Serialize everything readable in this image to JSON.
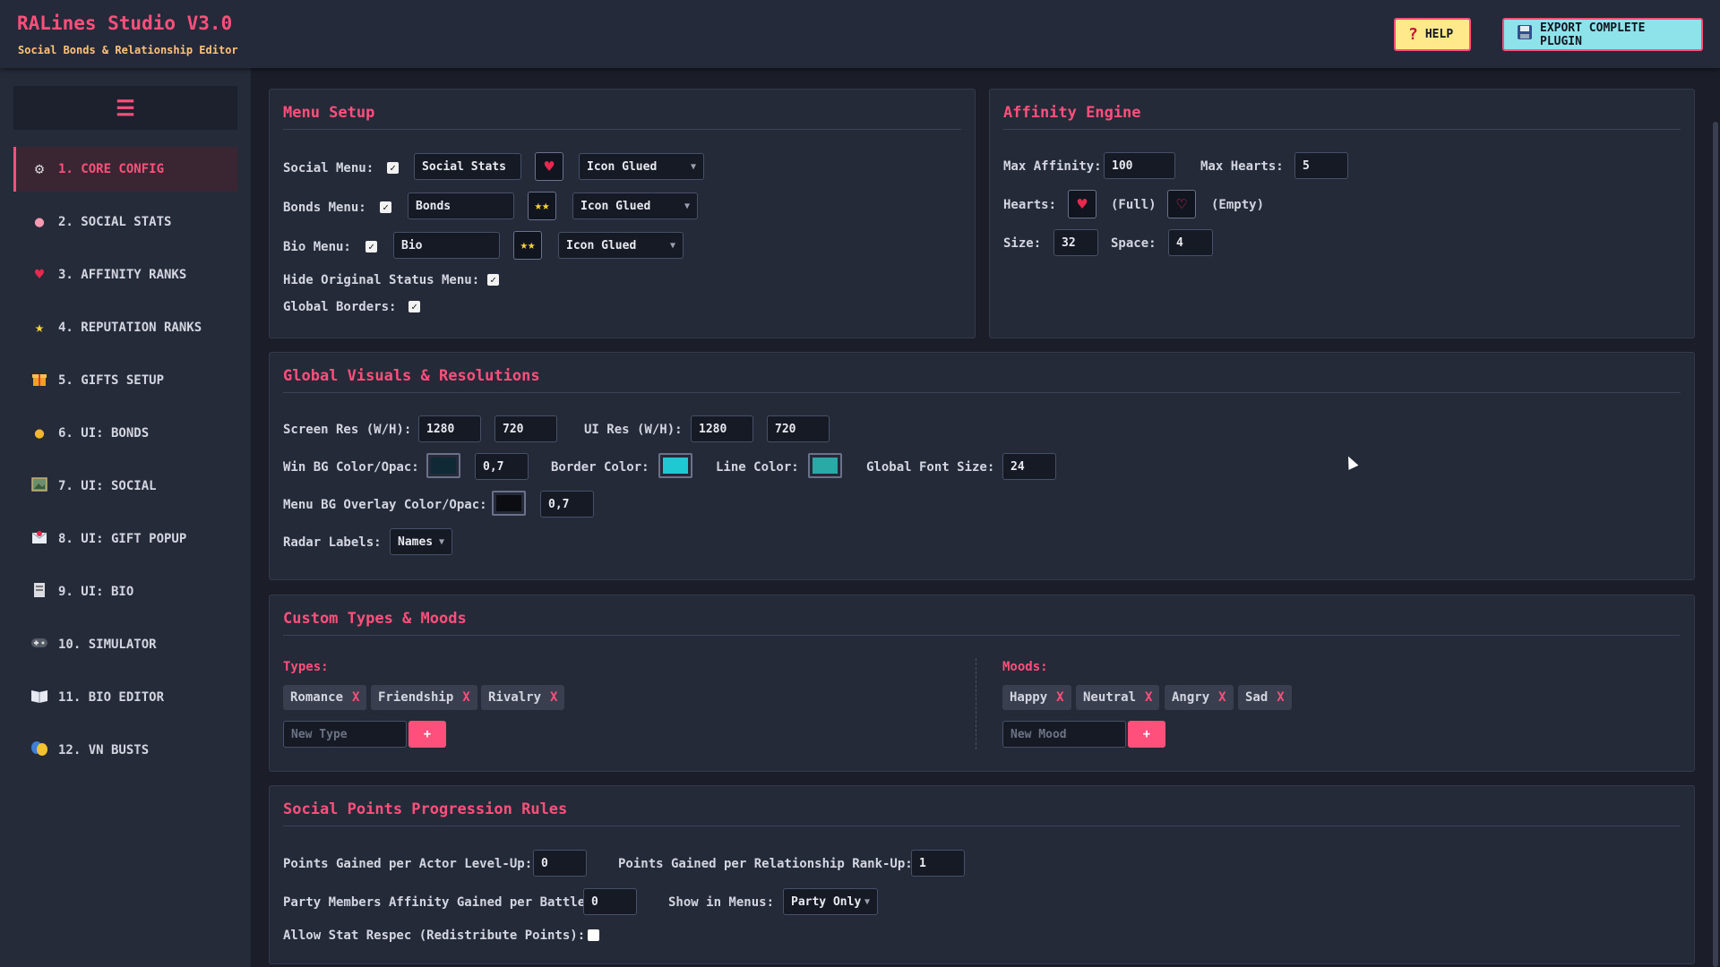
{
  "header": {
    "title": "RALines Studio V3.0",
    "subtitle": "Social Bonds & Relationship Editor",
    "help_label": "HELP",
    "export_label": "EXPORT COMPLETE PLUGIN",
    "help_icon": "question-icon",
    "export_icon": "floppy-disk-icon"
  },
  "sidebar": {
    "toggle_icon": "hamburger-icon",
    "items": [
      {
        "label": "1. CORE CONFIG",
        "icon": "gear-icon",
        "active": true
      },
      {
        "label": "2. SOCIAL STATS",
        "icon": "brain-icon"
      },
      {
        "label": "3. AFFINITY RANKS",
        "icon": "heart-icon"
      },
      {
        "label": "4. REPUTATION RANKS",
        "icon": "star-icon"
      },
      {
        "label": "5. GIFTS SETUP",
        "icon": "gift-icon"
      },
      {
        "label": "6. UI: BONDS",
        "icon": "palette-icon"
      },
      {
        "label": "7. UI: SOCIAL",
        "icon": "picture-icon"
      },
      {
        "label": "8. UI: GIFT POPUP",
        "icon": "envelope-icon"
      },
      {
        "label": "9. UI: BIO",
        "icon": "document-icon"
      },
      {
        "label": "10. SIMULATOR",
        "icon": "gamepad-icon"
      },
      {
        "label": "11. BIO EDITOR",
        "icon": "book-icon"
      },
      {
        "label": "12. VN BUSTS",
        "icon": "masks-icon"
      }
    ]
  },
  "menu_setup": {
    "title": "Menu Setup",
    "social_label": "Social Menu:",
    "social_name": "Social Stats",
    "social_mode": "Icon Glued",
    "bonds_label": "Bonds Menu:",
    "bonds_name": "Bonds",
    "bonds_mode": "Icon Glued",
    "bio_label": "Bio Menu:",
    "bio_name": "Bio",
    "bio_mode": "Icon Glued",
    "hide_label": "Hide Original Status Menu:",
    "borders_label": "Global Borders:"
  },
  "affinity": {
    "title": "Affinity Engine",
    "max_affinity_label": "Max Affinity:",
    "max_affinity": "100",
    "max_hearts_label": "Max Hearts:",
    "max_hearts": "5",
    "hearts_label": "Hearts:",
    "full_label": "(Full)",
    "empty_label": "(Empty)",
    "size_label": "Size:",
    "size": "32",
    "space_label": "Space:",
    "space": "4"
  },
  "visuals": {
    "title": "Global Visuals & Resolutions",
    "screen_res_label": "Screen Res (W/H):",
    "screen_w": "1280",
    "screen_h": "720",
    "ui_res_label": "UI Res (W/H):",
    "ui_w": "1280",
    "ui_h": "720",
    "win_bg_label": "Win BG Color/Opac:",
    "win_bg_opac": "0,7",
    "border_label": "Border Color:",
    "line_label": "Line Color:",
    "font_size_label": "Global Font Size:",
    "font_size": "24",
    "overlay_label": "Menu BG Overlay Color/Opac:",
    "overlay_opac": "0,7",
    "radar_label": "Radar Labels:",
    "radar_value": "Names",
    "colors": {
      "win_bg": "#0f2a35",
      "border": "#1ec9d3",
      "line": "#2aaaa6",
      "overlay": "#0b0d12"
    }
  },
  "custom": {
    "title": "Custom Types & Moods",
    "types_label": "Types:",
    "types": [
      "Romance",
      "Friendship",
      "Rivalry"
    ],
    "new_type_placeholder": "New Type",
    "moods_label": "Moods:",
    "moods": [
      "Happy",
      "Neutral",
      "Angry",
      "Sad"
    ],
    "new_mood_placeholder": "New Mood",
    "remove_label": "X",
    "add_label": "+"
  },
  "progression": {
    "title": "Social Points Progression Rules",
    "actor_label": "Points Gained per Actor Level-Up:",
    "actor_value": "0",
    "rank_label": "Points Gained per Relationship Rank-Up:",
    "rank_value": "1",
    "party_label": "Party Members Affinity Gained per Battle:",
    "party_value": "0",
    "show_label": "Show in Menus:",
    "show_value": "Party Only",
    "respec_label": "Allow Stat Respec (Redistribute Points):"
  },
  "theme": {
    "accent": "#ff4f7b",
    "bg": "#1b1e29",
    "panel": "#252a39"
  }
}
